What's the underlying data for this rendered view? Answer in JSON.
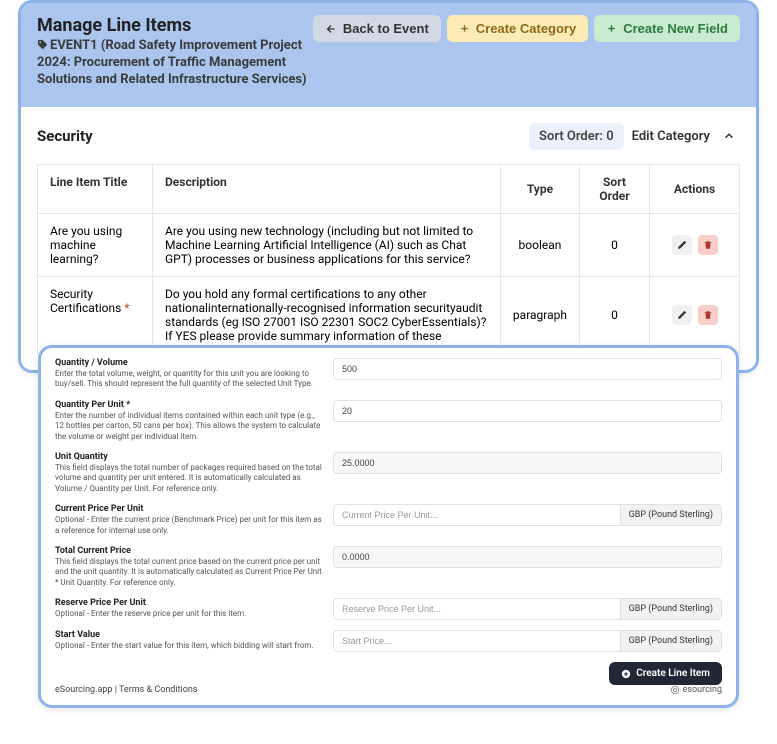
{
  "header": {
    "title": "Manage Line Items",
    "subtitle": "EVENT1 (Road Safety Improvement Project 2024: Procurement of Traffic Management Solutions and Related Infrastructure Services)",
    "back": "Back to Event",
    "create_cat": "Create Category",
    "create_field": "Create New Field"
  },
  "category": {
    "name": "Security",
    "sort_order": "Sort Order: 0",
    "edit": "Edit Category",
    "th_title": "Line Item Title",
    "th_desc": "Description",
    "th_type": "Type",
    "th_so": "Sort Order",
    "th_act": "Actions",
    "rows": [
      {
        "title": "Are you using machine learning?",
        "desc": "Are you using new technology (including but not limited to Machine Learning Artificial Intelligence (AI) such as Chat GPT) processes or business applications for this service?",
        "type": "boolean",
        "so": "0"
      },
      {
        "title": "Security Certifications",
        "required": true,
        "desc": "Do you hold any formal certifications to any other nationalinternationally-recognised information securityaudit standards (eg ISO 27001 ISO 22301 SOC2 CyberEssentials)? If YES please provide summary information of these",
        "type": "paragraph",
        "so": "0"
      }
    ]
  },
  "form": {
    "qty_vol_label": "Quantity / Volume",
    "qty_vol_help": "Enter the total volume, weight, or quantity for this unit you are looking to buy/sell. This should represent the full quantity of the selected Unit Type.",
    "qty_vol_val": "500",
    "qpu_label": "Quantity Per Unit *",
    "qpu_help": "Enter the number of individual items contained within each unit type (e.g., 12 bottles per carton, 50 cans per box). This allows the system to calculate the volume or weight per individual item.",
    "qpu_val": "20",
    "uq_label": "Unit Quantity",
    "uq_help": "This field displays the total number of packages required based on the total volume and quantity per unit entered. It is automatically calculated as Volume / Quantity per Unit. For reference only.",
    "uq_val": "25.0000",
    "cpu_label": "Current Price Per Unit",
    "cpu_help": "Optional - Enter the current price (Benchmark Price) per unit for this item as a reference for internal use only.",
    "cpu_ph": "Current Price Per Unit...",
    "tcp_label": "Total Current Price",
    "tcp_help": "This field displays the total current price based on the current price per unit and the unit quantity. It is automatically calculated as Current Price Per Unit * Unit Quantity. For reference only.",
    "tcp_val": "0.0000",
    "rpu_label": "Reserve Price Per Unit",
    "rpu_help": "Optional - Enter the reserve price per unit for this item.",
    "rpu_ph": "Reserve Price Per Unit...",
    "sv_label": "Start Value",
    "sv_help": "Optional - Enter the start value for this item, which bidding will start from.",
    "sv_ph": "Start Price...",
    "currency": "GBP (Pound Sterling)",
    "create": "Create Line Item"
  },
  "footer": {
    "app": "eSourcing.app",
    "sep": " | ",
    "terms": "Terms & Conditions",
    "brand": "esourcing"
  }
}
